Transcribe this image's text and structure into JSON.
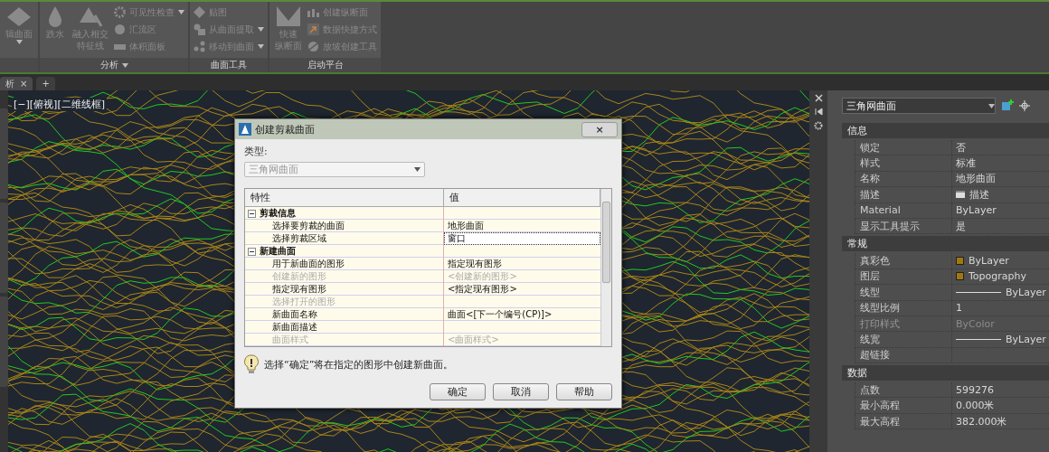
{
  "ribbon": {
    "panels": [
      {
        "buttons": [
          {
            "kind": "large",
            "lines": [
              "辑曲面"
            ],
            "dropdown": true
          }
        ]
      },
      {
        "title": "分析",
        "title_dropdown": true,
        "buttons": [
          {
            "kind": "large",
            "lines": [
              "跌水"
            ],
            "dropdown": false
          },
          {
            "kind": "large",
            "lines": [
              "融入相交",
              "特征线"
            ],
            "dropdown": false
          },
          {
            "kind": "small",
            "label": "可见性检查",
            "dropdown": true
          },
          {
            "kind": "small",
            "label": "汇流区",
            "dropdown": false
          },
          {
            "kind": "small",
            "label": "体积面板",
            "dropdown": false
          }
        ]
      },
      {
        "title": "曲面工具",
        "title_dropdown": false,
        "buttons": [
          {
            "kind": "small",
            "label": "贴图",
            "dropdown": false
          },
          {
            "kind": "small",
            "label": "从曲面提取",
            "dropdown": true
          },
          {
            "kind": "small",
            "label": "移动到曲面",
            "dropdown": true
          }
        ]
      },
      {
        "title": "启动平台",
        "title_dropdown": false,
        "buttons": [
          {
            "kind": "large",
            "lines": [
              "快速",
              "纵断面"
            ],
            "dropdown": false
          },
          {
            "kind": "small",
            "label": "创建纵断面",
            "dropdown": false
          },
          {
            "kind": "small",
            "label": "数据快捷方式",
            "dropdown": false
          },
          {
            "kind": "small",
            "label": "放坡创建工具",
            "dropdown": false
          }
        ]
      }
    ]
  },
  "doc_tabs": [
    {
      "label": "析",
      "close": "×",
      "selected": true
    },
    {
      "label": "+",
      "selected": false
    }
  ],
  "viewport": {
    "label": "[−][俯视][二维线框]"
  },
  "dialog": {
    "title": "创建剪裁曲面",
    "close": "×",
    "type_label": "类型:",
    "type_value": "三角网曲面",
    "columns": [
      "特性",
      "值"
    ],
    "groups": [
      {
        "label": "剪裁信息",
        "expanded": true,
        "children": [
          {
            "property": "选择要剪裁的曲面",
            "value": "地形曲面",
            "disabled": false,
            "focused": false
          },
          {
            "property": "选择剪裁区域",
            "value": "窗口",
            "disabled": false,
            "focused": true
          }
        ]
      },
      {
        "label": "新建曲面",
        "expanded": true,
        "children": [
          {
            "property": "用于新曲面的图形",
            "value": "指定现有图形",
            "disabled": false,
            "focused": false
          },
          {
            "property": "创建新的图形",
            "value": "<创建新的图形>",
            "disabled": true,
            "focused": false
          },
          {
            "property": "指定现有图形",
            "value": "<指定现有图形>",
            "disabled": false,
            "focused": false
          },
          {
            "property": "选择打开的图形",
            "disabled": true,
            "focused": false
          },
          {
            "property": "新曲面名称",
            "value": "曲面<[下一个编号(CP)]>",
            "disabled": false,
            "focused": false
          },
          {
            "property": "新曲面描述",
            "disabled": false,
            "focused": false
          },
          {
            "property": "曲面样式",
            "value": "<曲面样式>",
            "disabled": true,
            "focused": false
          }
        ]
      }
    ],
    "info": "选择“确定”将在指定的图形中创建新曲面。",
    "buttons": [
      {
        "label": "确定"
      },
      {
        "label": "取消"
      },
      {
        "label": "帮助"
      }
    ]
  },
  "properties": {
    "object_type": "三角网曲面",
    "sections": [
      {
        "title": "信息",
        "rows": [
          {
            "kind": "text",
            "label": "锁定",
            "value": "否"
          },
          {
            "kind": "text",
            "label": "样式",
            "value": "标准"
          },
          {
            "kind": "text",
            "label": "名称",
            "value": "地形曲面"
          },
          {
            "kind": "icon_text",
            "label": "描述",
            "value": "描述"
          },
          {
            "kind": "text",
            "label": "Material",
            "value": "ByLayer"
          },
          {
            "kind": "text",
            "label": "显示工具提示",
            "value": "是"
          }
        ]
      },
      {
        "title": "常规",
        "rows": [
          {
            "kind": "color",
            "label": "真彩色",
            "value": "ByLayer",
            "color": "#a07810",
            "disabled": false
          },
          {
            "kind": "color",
            "label": "图层",
            "value": "Topography",
            "color": "#a07810",
            "disabled": false
          },
          {
            "kind": "linetype",
            "label": "线型",
            "value": "ByLayer",
            "disabled": false
          },
          {
            "kind": "text",
            "label": "线型比例",
            "value": "1",
            "disabled": false
          },
          {
            "kind": "text",
            "label": "打印样式",
            "value": "ByColor",
            "disabled": true
          },
          {
            "kind": "linetype",
            "label": "线宽",
            "value": "ByLayer",
            "disabled": false
          },
          {
            "kind": "text",
            "label": "超链接",
            "disabled": false
          }
        ]
      },
      {
        "title": "数据",
        "rows": [
          {
            "kind": "text",
            "label": "点数",
            "value": "599276"
          },
          {
            "kind": "text",
            "label": "最小高程",
            "value": "0.000米"
          },
          {
            "kind": "text",
            "label": "最大高程",
            "value": "382.000米"
          }
        ]
      }
    ]
  }
}
